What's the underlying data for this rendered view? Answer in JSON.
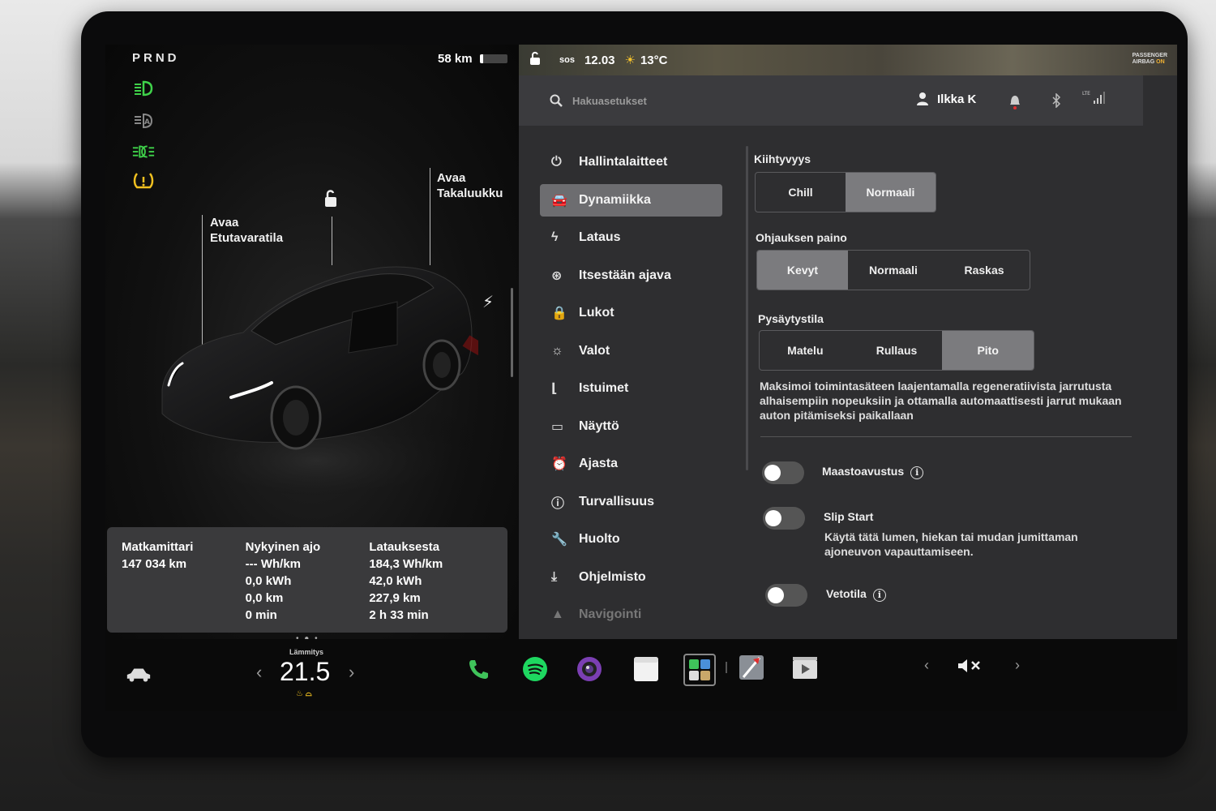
{
  "left": {
    "gear": "PRND",
    "range": "58 km",
    "front_trunk": [
      "Avaa",
      "Etutavaratila"
    ],
    "rear_trunk": [
      "Avaa",
      "Takaluukku"
    ],
    "stats": {
      "odometer": {
        "title": "Matkamittari",
        "lines": [
          "147 034 km"
        ]
      },
      "current": {
        "title": "Nykyinen ajo",
        "lines": [
          "--- Wh/km",
          "0,0 kWh",
          "0,0 km",
          "0 min"
        ]
      },
      "since_charge": {
        "title": "Latauksesta",
        "lines": [
          "184,3 Wh/km",
          "42,0 kWh",
          "227,9 km",
          "2 h 33 min"
        ]
      }
    },
    "colors": {
      "green_tell": "#3fd24a",
      "yellow_tell": "#f0c020"
    }
  },
  "status_bar": {
    "sos": "sos",
    "time": "12.03",
    "temperature": "13°C",
    "airbag_line1": "PASSENGER",
    "airbag_line2": "AIRBAG",
    "airbag_state": "ON",
    "lte": "LTE"
  },
  "search": {
    "placeholder": "Hakuasetukset"
  },
  "user": {
    "name": "Ilkka K"
  },
  "nav": [
    {
      "label": "Hallintalaitteet",
      "icon": "toggle-icon"
    },
    {
      "label": "Dynamiikka",
      "icon": "car-icon",
      "active": true
    },
    {
      "label": "Lataus",
      "icon": "bolt-icon"
    },
    {
      "label": "Itsestään ajava",
      "icon": "steering-wheel-icon"
    },
    {
      "label": "Lukot",
      "icon": "lock-icon"
    },
    {
      "label": "Valot",
      "icon": "sun-icon"
    },
    {
      "label": "Istuimet",
      "icon": "seat-icon"
    },
    {
      "label": "Näyttö",
      "icon": "display-icon"
    },
    {
      "label": "Ajasta",
      "icon": "alarm-icon"
    },
    {
      "label": "Turvallisuus",
      "icon": "safety-icon"
    },
    {
      "label": "Huolto",
      "icon": "wrench-icon"
    },
    {
      "label": "Ohjelmisto",
      "icon": "download-icon"
    },
    {
      "label": "Navigointi",
      "icon": "navigation-icon"
    }
  ],
  "settings": {
    "acceleration": {
      "title": "Kiihtyvyys",
      "options": [
        "Chill",
        "Normaali"
      ],
      "selected": "Normaali"
    },
    "steering": {
      "title": "Ohjauksen paino",
      "options": [
        "Kevyt",
        "Normaali",
        "Raskas"
      ],
      "selected": "Kevyt"
    },
    "stopping": {
      "title": "Pysäytystila",
      "options": [
        "Matelu",
        "Rullaus",
        "Pito"
      ],
      "selected": "Pito"
    },
    "stopping_desc": "Maksimoi toimintasäteen laajentamalla regeneratiivista jarrutusta alhaisempiin nopeuksiin ja ottamalla automaattisesti jarrut mukaan auton pitämiseksi paikallaan",
    "off_road": {
      "label": "Maastoavustus",
      "on": false
    },
    "slip_start": {
      "label": "Slip Start",
      "desc": "Käytä tätä lumen, hiekan tai mudan jumittaman ajoneuvon vapauttamiseen.",
      "on": false
    },
    "tow_mode": {
      "label": "Vetotila",
      "on": false
    }
  },
  "dock": {
    "climate_label": "Lämmitys",
    "temperature": "21.5"
  }
}
